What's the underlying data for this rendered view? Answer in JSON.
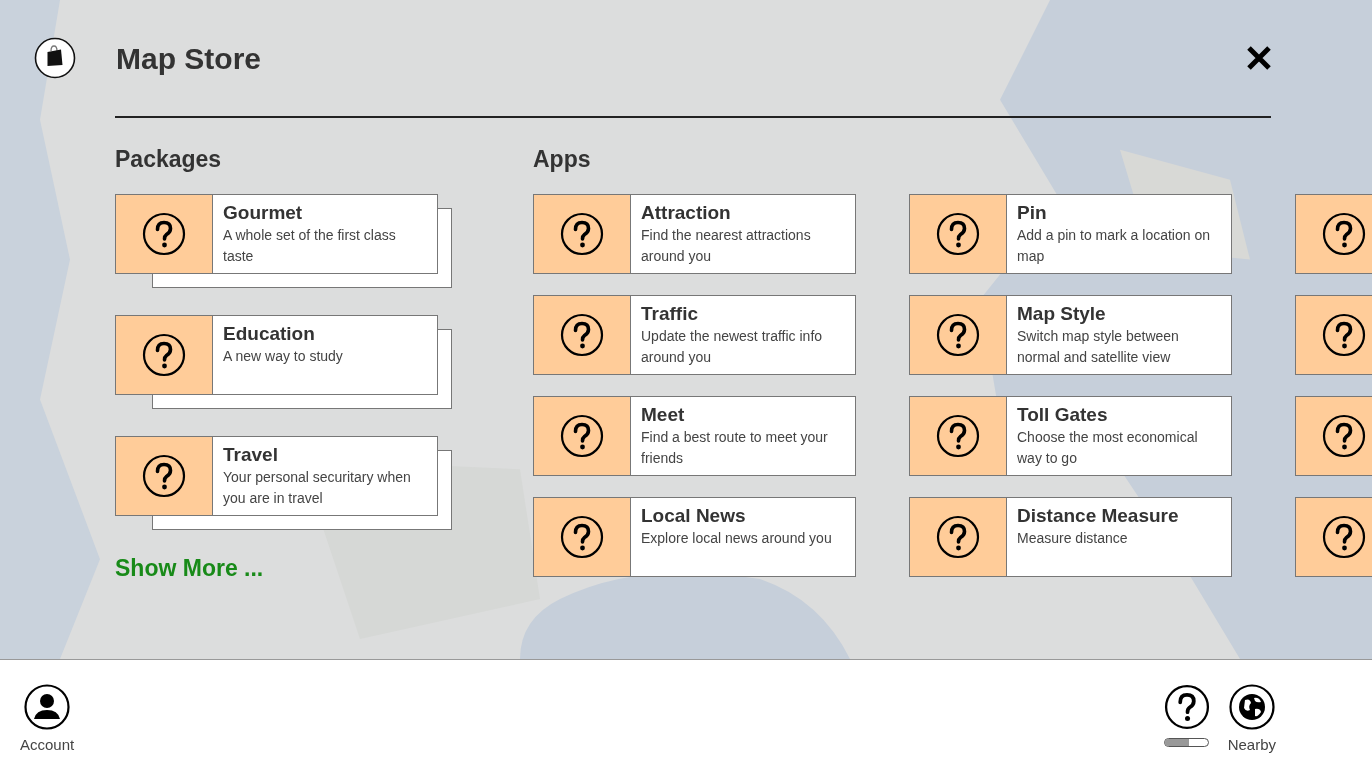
{
  "header": {
    "title": "Map Store"
  },
  "packages": {
    "heading": "Packages",
    "items": [
      {
        "title": "Gourmet",
        "description": "A whole set of the first class taste"
      },
      {
        "title": "Education",
        "description": "A new way to study"
      },
      {
        "title": "Travel",
        "description": "Your personal securitary when you are in travel"
      }
    ],
    "show_more": "Show More ..."
  },
  "apps": {
    "heading": "Apps",
    "items": [
      {
        "title": "Attraction",
        "description": "Find the nearest attractions around you"
      },
      {
        "title": "Traffic",
        "description": "Update the newest traffic info around you"
      },
      {
        "title": "Meet",
        "description": "Find a best route to meet your friends"
      },
      {
        "title": "Local News",
        "description": "Explore local news around you"
      },
      {
        "title": "Pin",
        "description": "Add a pin to mark a location on map"
      },
      {
        "title": "Map Style",
        "description": "Switch map style between normal and satellite view"
      },
      {
        "title": "Toll Gates",
        "description": "Choose the most economical way to go"
      },
      {
        "title": "Distance Measure",
        "description": "Measure distance"
      }
    ],
    "cut_off_tiles": [
      {
        "kind": "tile"
      },
      {
        "kind": "tile"
      },
      {
        "kind": "tile"
      },
      {
        "kind": "tile"
      }
    ]
  },
  "footer": {
    "account": {
      "label": "Account"
    },
    "help": {
      "level": 0.55
    },
    "nearby": {
      "label": "Nearby"
    }
  }
}
